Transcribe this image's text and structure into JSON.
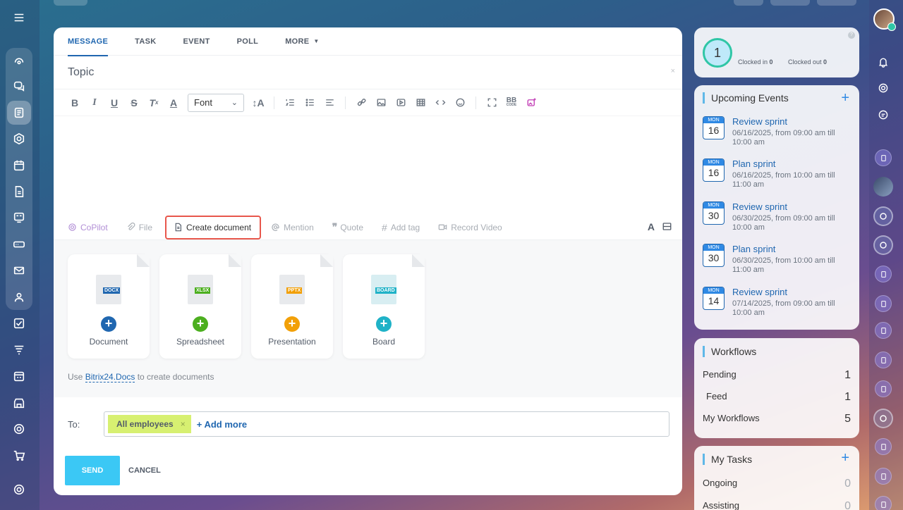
{
  "tabs": [
    {
      "label": "MESSAGE"
    },
    {
      "label": "TASK"
    },
    {
      "label": "EVENT"
    },
    {
      "label": "POLL"
    },
    {
      "label": "MORE"
    }
  ],
  "topic": {
    "placeholder": "Topic",
    "close": "×"
  },
  "toolbar": {
    "font_label": "Font",
    "bb_label": "BB",
    "bb_sub": "CODE"
  },
  "actions": {
    "copilot": "CoPilot",
    "file": "File",
    "create_document": "Create document",
    "mention": "Mention",
    "quote": "Quote",
    "add_tag": "Add tag",
    "record_video": "Record Video",
    "text_a": "A"
  },
  "documents": [
    {
      "label": "Document",
      "ext": "DOCX",
      "color": "#2067b0"
    },
    {
      "label": "Spreadsheet",
      "ext": "XLSX",
      "color": "#4caf1f"
    },
    {
      "label": "Presentation",
      "ext": "PPTX",
      "color": "#f2a008"
    },
    {
      "label": "Board",
      "ext": "BOARD",
      "color": "#1fb2c7"
    }
  ],
  "docs_hint": {
    "prefix": "Use",
    "link": "Bitrix24.Docs",
    "suffix": "to create documents"
  },
  "recipients": {
    "to_label": "To:",
    "chip": "All employees",
    "chip_remove": "×",
    "add_more": "+ Add more"
  },
  "buttons": {
    "send": "SEND",
    "cancel": "CANCEL"
  },
  "timeman": {
    "count": "1",
    "clocked_in_label": "Clocked in",
    "clocked_in": "0",
    "clocked_out_label": "Clocked out",
    "clocked_out": "0",
    "help": "?"
  },
  "events": {
    "title": "Upcoming Events",
    "add": "+",
    "items": [
      {
        "month": "MON",
        "day": "16",
        "title": "Review sprint",
        "time": "06/16/2025, from 09:00 am till 10:00 am"
      },
      {
        "month": "MON",
        "day": "16",
        "title": "Plan sprint",
        "time": "06/16/2025, from 10:00 am till 11:00 am"
      },
      {
        "month": "MON",
        "day": "30",
        "title": "Review sprint",
        "time": "06/30/2025, from 09:00 am till 10:00 am"
      },
      {
        "month": "MON",
        "day": "30",
        "title": "Plan sprint",
        "time": "06/30/2025, from 10:00 am till 11:00 am"
      },
      {
        "month": "MON",
        "day": "14",
        "title": "Review sprint",
        "time": "07/14/2025, from 09:00 am till 10:00 am"
      }
    ]
  },
  "workflows": {
    "title": "Workflows",
    "rows": [
      {
        "label": "Pending",
        "count": "1"
      },
      {
        "label": "Feed",
        "count": "1"
      },
      {
        "label": "My Workflows",
        "count": "5"
      }
    ]
  },
  "tasks": {
    "title": "My Tasks",
    "add": "+",
    "rows": [
      {
        "label": "Ongoing",
        "count": "0"
      },
      {
        "label": "Assisting",
        "count": "0"
      }
    ]
  }
}
